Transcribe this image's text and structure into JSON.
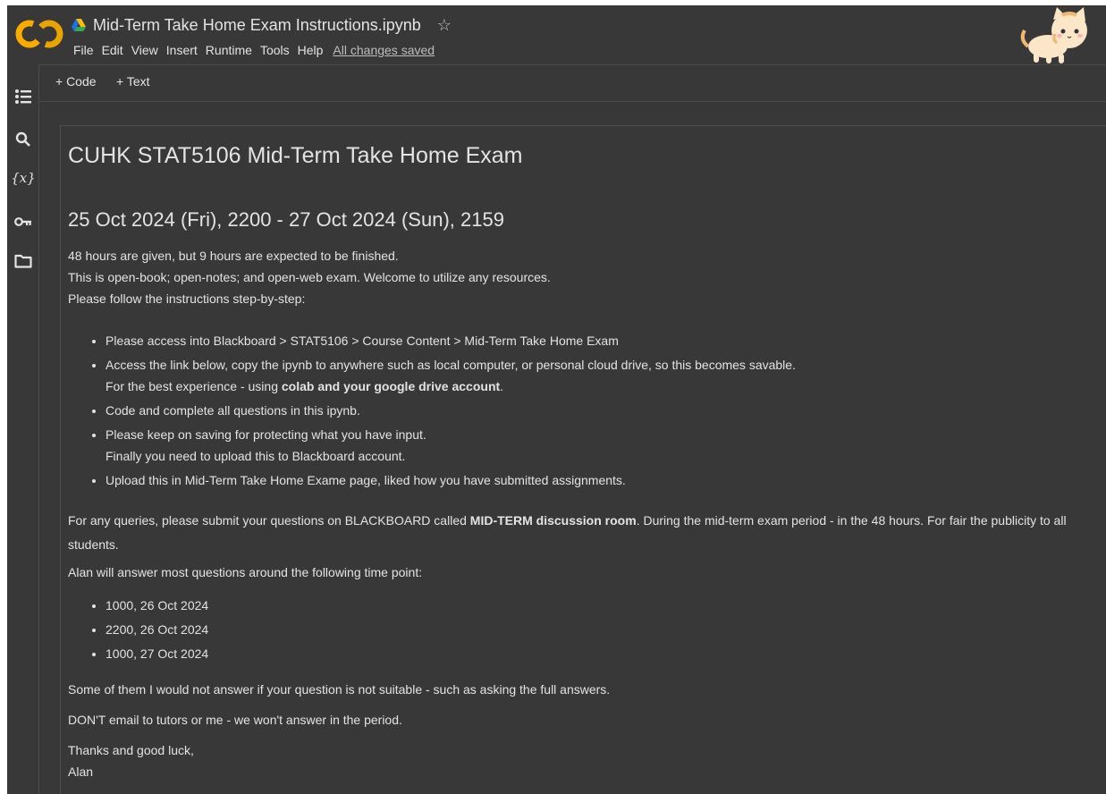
{
  "header": {
    "logo_text": "CO",
    "doc_title": "Mid-Term Take Home Exam Instructions.ipynb",
    "star_glyph": "☆",
    "menu": [
      "File",
      "Edit",
      "View",
      "Insert",
      "Runtime",
      "Tools",
      "Help"
    ],
    "save_status": "All changes saved"
  },
  "toolbar": {
    "add_code": "+ Code",
    "add_text": "+ Text"
  },
  "sidebar": {
    "icons": [
      "table-of-contents-icon",
      "search-icon",
      "variables-icon",
      "key-icon",
      "folder-icon"
    ],
    "variables_glyph": "{x}"
  },
  "cell": {
    "h1": "CUHK STAT5106 Mid-Term Take Home Exam",
    "h2": "25 Oct 2024 (Fri), 2200 - 27 Oct 2024 (Sun), 2159",
    "intro": [
      "48 hours are given, but 9 hours are expected to be finished.",
      "This is open-book; open-notes; and open-web exam. Welcome to utilize any resources.",
      "Please follow the instructions step-by-step:"
    ],
    "steps": {
      "s1": "Please access into Blackboard > STAT5106 > Course Content > Mid-Term Take Home Exam",
      "s2_line1": "Access the link below, copy the ipynb to anywhere such as local computer, or personal cloud drive, so this becomes savable.",
      "s2_line2_prefix": "For the best experience - using ",
      "s2_line2_bold": "colab and your google drive account",
      "s2_line2_suffix": ".",
      "s3": "Code and complete all questions in this ipynb.",
      "s4_line1": "Please keep on saving for protecting what you have input.",
      "s4_line2": "Finally you need to upload this to Blackboard account.",
      "s5": "Upload this in Mid-Term Take Home Exame page, liked how you have submitted assignments."
    },
    "queries": {
      "prefix": "For any queries, please submit your questions on BLACKBOARD called ",
      "bold": "MID-TERM discussion room",
      "suffix": ". During the mid-term exam period - in the 48 hours. For fair the publicity to all students."
    },
    "answer_intro": "Alan will answer most questions around the following time point:",
    "timepoints": [
      "1000, 26 Oct 2024",
      "2200, 26 Oct 2024",
      "1000, 27 Oct 2024"
    ],
    "not_answer": "Some of them I would not answer if your question is not suitable - such as asking the full answers.",
    "dont_email": "DON'T email to tutors or me - we won't answer in the period.",
    "thanks": "Thanks and good luck,",
    "signature": "Alan"
  },
  "colors": {
    "background": "#383838",
    "text": "#e3e3e3",
    "logo_orange": "#f9ab00",
    "logo_yellow": "#e37400"
  }
}
